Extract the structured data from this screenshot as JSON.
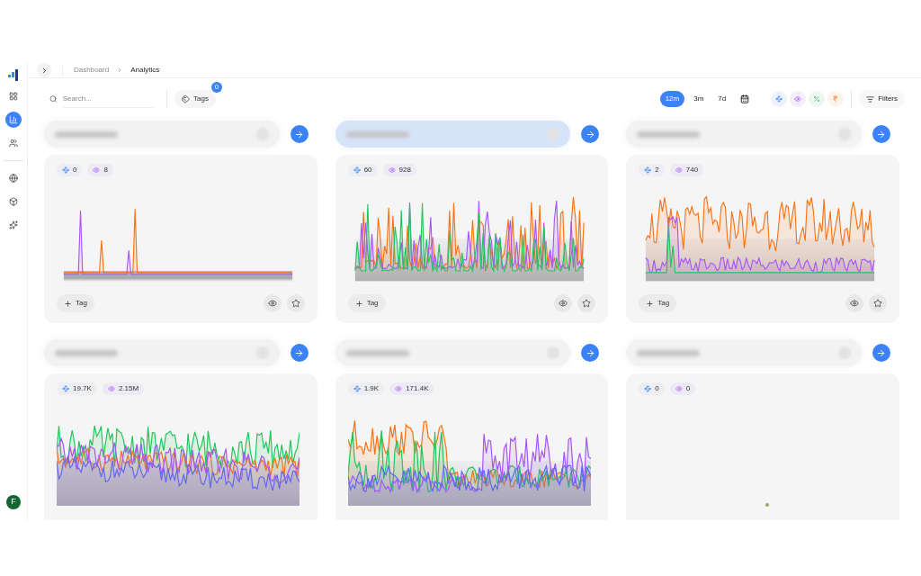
{
  "sidebar": {
    "items": [
      {
        "selected": false
      },
      {
        "selected": true
      },
      {
        "selected": false
      },
      {
        "selected": false
      },
      {
        "selected": false
      },
      {
        "selected": false
      }
    ],
    "avatar": "F"
  },
  "breadcrumb": [
    "Dashboard",
    "Analytics"
  ],
  "toolbar": {
    "search": {
      "placeholder": "Search..."
    },
    "tags": {
      "label": "Tags",
      "count": "0"
    },
    "periods": [
      {
        "label": "12m",
        "selected": true
      },
      {
        "label": "3m",
        "selected": false
      },
      {
        "label": "7d",
        "selected": false
      }
    ],
    "filters": "Filters"
  },
  "cards": [
    {
      "selected": false,
      "kind": "spikes",
      "stats": [
        "0",
        "8"
      ],
      "tag_button": "Tag"
    },
    {
      "selected": true,
      "kind": "noisy",
      "stats": [
        "60",
        "928"
      ],
      "tag_button": "Tag"
    },
    {
      "selected": false,
      "kind": "orange",
      "stats": [
        "2",
        "740"
      ],
      "tag_button": "Tag"
    },
    {
      "selected": false,
      "kind": "dense",
      "stats": [
        "19.7K",
        "2.15M"
      ]
    },
    {
      "selected": false,
      "kind": "mixed",
      "stats": [
        "1.9K",
        "171.4K"
      ]
    },
    {
      "selected": false,
      "kind": "empty",
      "stats": [
        "0",
        "0"
      ]
    }
  ]
}
